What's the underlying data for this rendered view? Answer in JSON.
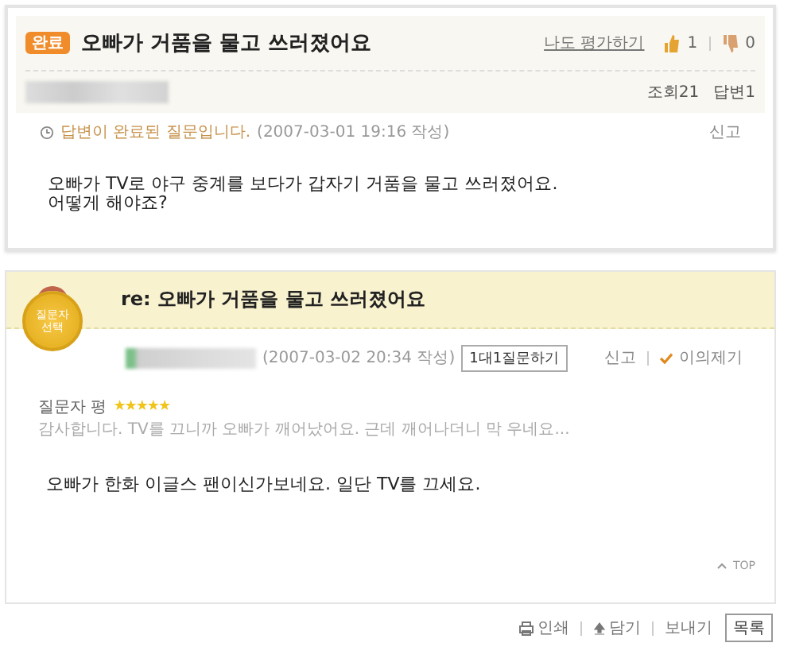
{
  "question": {
    "status_badge": "완료",
    "title": "오빠가 거품을 물고 쓰러졌어요",
    "rate_link": "나도 평가하기",
    "likes": "1",
    "dislikes": "0",
    "views": "조회21",
    "answers": "답변1",
    "status_note": "답변이 완료된 질문입니다.",
    "timestamp": "(2007-03-01 19:16 작성)",
    "report": "신고",
    "body": [
      "오빠가 TV로 야구 중계를 보다가 갑자기 거품을 물고 쓰러졌어요.",
      "어떻게 해야죠?"
    ]
  },
  "answer": {
    "medal": [
      "질문자",
      "선택"
    ],
    "title": "re: 오빠가 거품을 물고 쓰러졌어요",
    "timestamp": "(2007-03-02 20:34 작성)",
    "ask_button": "1대1질문하기",
    "report": "신고",
    "objection": "이의제기",
    "rating_label": "질문자 평",
    "stars": 5,
    "comment": "감사합니다. TV를 끄니까 오빠가 깨어났어요. 근데 깨어나더니 막 우네요...",
    "body": "오빠가 한화 이글스 팬이신가보네요. 일단 TV를 끄세요.",
    "top_link": "TOP"
  },
  "footer": {
    "actions": [
      {
        "kind": "print",
        "label": "인쇄"
      },
      {
        "kind": "save",
        "label": "담기"
      },
      {
        "kind": "send",
        "label": "보내기"
      }
    ],
    "list_button": "목록"
  }
}
